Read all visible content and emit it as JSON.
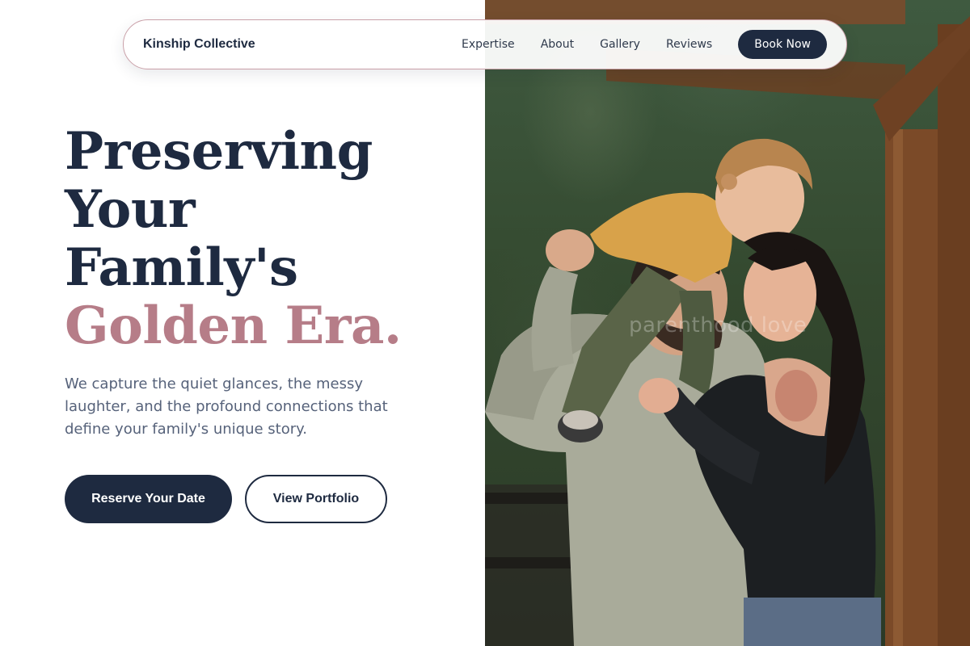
{
  "nav": {
    "brand": "Kinship Collective",
    "links": [
      "Expertise",
      "About",
      "Gallery",
      "Reviews"
    ],
    "cta": "Book Now"
  },
  "hero": {
    "headline_lines": [
      "Preserving",
      "Your",
      "Family's"
    ],
    "headline_accent": "Golden Era.",
    "subtext": "We capture the quiet glances, the messy laughter, and the profound connections that define your family's unique story.",
    "primary_cta": "Reserve Your Date",
    "secondary_cta": "View Portfolio",
    "image_watermark": "parenthood love"
  },
  "colors": {
    "navy": "#1e2a40",
    "rose_accent": "#b67d88",
    "body_text": "#56627a"
  }
}
